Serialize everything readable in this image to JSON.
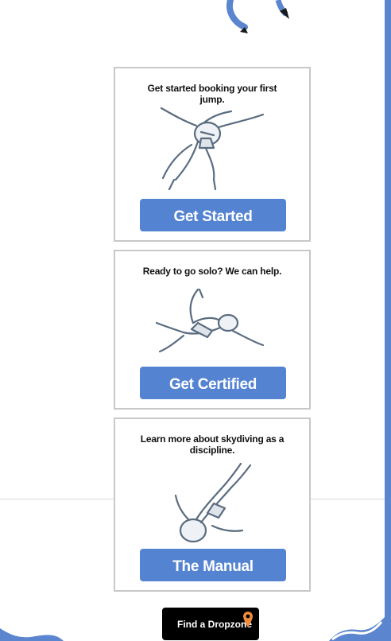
{
  "cards": [
    {
      "text": "Get started booking your first jump.",
      "button_label": "Get Started"
    },
    {
      "text": "Ready to go solo? We can help.",
      "button_label": "Get Certified"
    },
    {
      "text": "Learn more about skydiving as a discipline.",
      "button_label": "The Manual"
    }
  ],
  "find_dropzone": {
    "label": "Find a Dropzone",
    "icon": "map-pin-icon"
  },
  "colors": {
    "button_blue": "#5483d1",
    "border_gray": "#c8c8c8",
    "accent_strip": "#5b86cf",
    "pin_orange": "#f08a3c"
  }
}
